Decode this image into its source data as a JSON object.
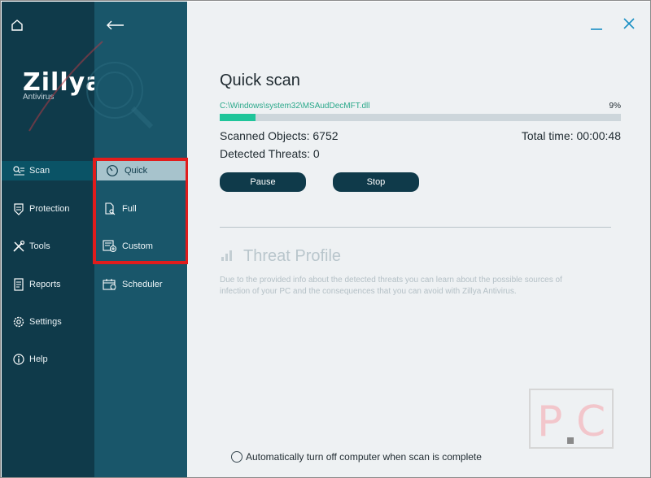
{
  "app": {
    "brand": "Zillya",
    "brand_sub": "Antivirus"
  },
  "rail": {
    "items": [
      {
        "label": "Scan",
        "icon": "scan-icon",
        "active": true
      },
      {
        "label": "Protection",
        "icon": "shield-icon"
      },
      {
        "label": "Tools",
        "icon": "tools-icon"
      },
      {
        "label": "Reports",
        "icon": "report-icon"
      },
      {
        "label": "Settings",
        "icon": "gear-icon"
      },
      {
        "label": "Help",
        "icon": "info-icon"
      }
    ]
  },
  "subpanel": {
    "items": [
      {
        "label": "Quick",
        "icon": "gauge-icon",
        "active": true
      },
      {
        "label": "Full",
        "icon": "file-search-icon"
      },
      {
        "label": "Custom",
        "icon": "custom-scan-icon"
      },
      {
        "label": "Scheduler",
        "icon": "calendar-icon"
      }
    ]
  },
  "scan": {
    "title": "Quick scan",
    "current_file": "C:\\Windows\\system32\\MSAudDecMFT.dll",
    "progress_label": "9%",
    "progress": 0.09,
    "scanned_objects": "Scanned Objects: 6752",
    "detected_threats": "Detected Threats: 0",
    "total_time": "Total time: 00:00:48",
    "pause_label": "Pause",
    "stop_label": "Stop"
  },
  "threat_profile": {
    "title": "Threat Profile",
    "description": "Due to the provided info about the detected threats you can learn about the possible sources of infection of your PC and the consequences that you can avoid with Zillya Antivirus."
  },
  "footer": {
    "auto_shutdown_label": "Automatically turn off computer when scan is complete",
    "auto_shutdown_checked": false
  },
  "colors": {
    "rail_bg": "#0f3a4a",
    "subpanel_bg": "#19566a",
    "accent": "#1fc59a",
    "highlight": "#e11c1c"
  }
}
